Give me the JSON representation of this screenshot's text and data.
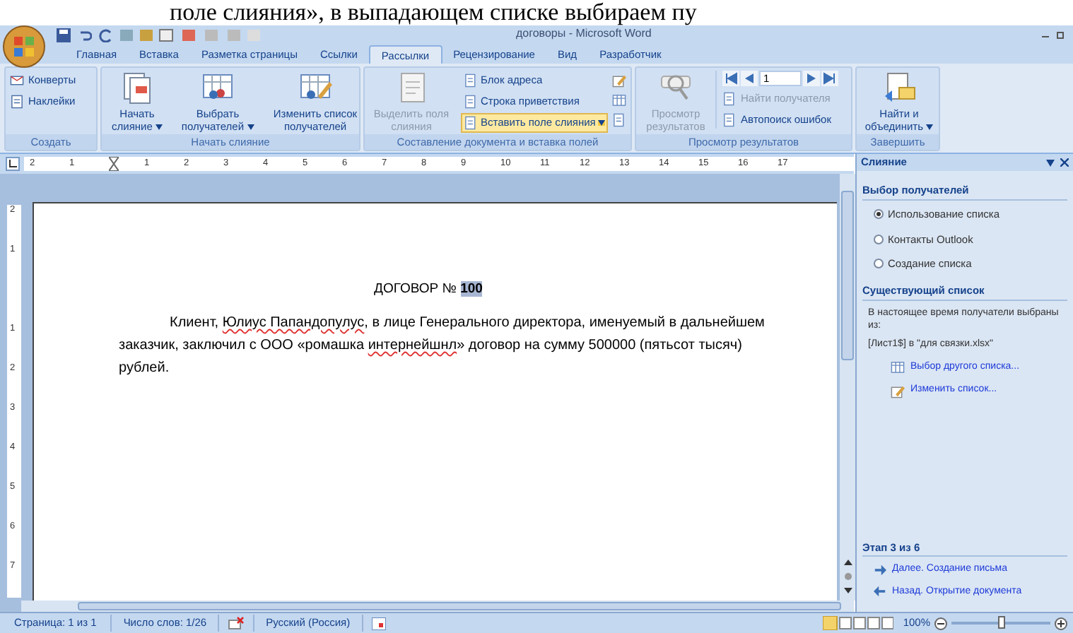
{
  "caption_fragment": "поле слияния», в выпадающем списке выбираем пу",
  "window": {
    "title": "договоры - Microsoft Word"
  },
  "tabs": [
    {
      "label": "Главная",
      "selected": false
    },
    {
      "label": "Вставка",
      "selected": false
    },
    {
      "label": "Разметка страницы",
      "selected": false
    },
    {
      "label": "Ссылки",
      "selected": false
    },
    {
      "label": "Рассылки",
      "selected": true
    },
    {
      "label": "Рецензирование",
      "selected": false
    },
    {
      "label": "Вид",
      "selected": false
    },
    {
      "label": "Разработчик",
      "selected": false
    }
  ],
  "ribbon_groups": [
    {
      "title": "Создать",
      "items": [
        {
          "kind": "small",
          "label": "Конверты",
          "disabled": false
        },
        {
          "kind": "small",
          "label": "Наклейки",
          "disabled": false
        }
      ]
    },
    {
      "title": "Начать слияние",
      "items": [
        {
          "kind": "large",
          "label": "Начать слияние",
          "dropdown": true,
          "disabled": false
        },
        {
          "kind": "large",
          "label": "Выбрать получателей",
          "dropdown": true,
          "disabled": false
        },
        {
          "kind": "large",
          "label": "Изменить список получателей",
          "dropdown": false,
          "disabled": false
        }
      ]
    },
    {
      "title": "Составление документа и вставка полей",
      "items": [
        {
          "kind": "large",
          "label": "Выделить поля слияния",
          "dropdown": false,
          "disabled": true
        },
        {
          "kind": "stack",
          "items": [
            {
              "label": "Блок адреса",
              "highlighted": false,
              "dropdown": false
            },
            {
              "label": "Строка приветствия",
              "highlighted": false,
              "dropdown": false
            },
            {
              "label": "Вставить поле слияния",
              "highlighted": true,
              "dropdown": true
            }
          ]
        }
      ]
    },
    {
      "title": "Просмотр результатов",
      "items": [
        {
          "kind": "large",
          "label": "Просмотр результатов",
          "dropdown": false,
          "disabled": true
        },
        {
          "kind": "nav",
          "record": "1",
          "items": [
            {
              "label": "Найти получателя",
              "disabled": true
            },
            {
              "label": "Автопоиск ошибок",
              "disabled": false
            }
          ]
        }
      ]
    },
    {
      "title": "Завершить",
      "items": [
        {
          "kind": "large",
          "label": "Найти и объединить",
          "dropdown": true,
          "disabled": false
        }
      ]
    }
  ],
  "ruler": {
    "labels": [
      "2",
      "1",
      "1",
      "2",
      "3",
      "4",
      "5",
      "6",
      "7",
      "8",
      "9",
      "10",
      "11",
      "12",
      "13",
      "14",
      "15",
      "16",
      "17"
    ],
    "vertical_labels": [
      "2",
      "1",
      "1",
      "2",
      "3",
      "4",
      "5",
      "6",
      "7"
    ]
  },
  "document": {
    "title": "ДОГОВОР №",
    "field": {
      "text": "100",
      "selected": true
    },
    "paragraph": [
      {
        "text": "Клиент,  ",
        "misspelled": false
      },
      {
        "text": "Юлиус Папандопулус",
        "misspelled": true
      },
      {
        "text": ", в лице Генерального директора, именуемый в дальнейшем заказчик, заключил с ООО «ромашка ",
        "misspelled": false
      },
      {
        "text": "интернейшнл",
        "misspelled": true
      },
      {
        "text": "» договор на сумму 500000  (пятьсот тысяч) рублей.",
        "misspelled": false
      }
    ]
  },
  "task_pane": {
    "title": "Слияние",
    "sections": [
      {
        "heading": "Выбор получателей",
        "options": [
          {
            "label": "Использование списка",
            "selected": true
          },
          {
            "label": "Контакты Outlook",
            "selected": false
          },
          {
            "label": "Создание списка",
            "selected": false
          }
        ]
      },
      {
        "heading": "Существующий список",
        "text": "В настоящее время получатели выбраны из:",
        "source": "[Лист1$] в \"для связки.xlsx\"",
        "links": [
          "Выбор другого списка...",
          "Изменить список..."
        ]
      }
    ],
    "step": "Этап 3 из 6",
    "nav": [
      "Далее. Создание письма",
      "Назад. Открытие документа"
    ]
  },
  "status_bar": {
    "page": "Страница: 1 из 1",
    "words": "Число слов: 1/26",
    "language": "Русский (Россия)",
    "zoom": "100%",
    "zoom_slider": {
      "level": 0.5
    }
  }
}
